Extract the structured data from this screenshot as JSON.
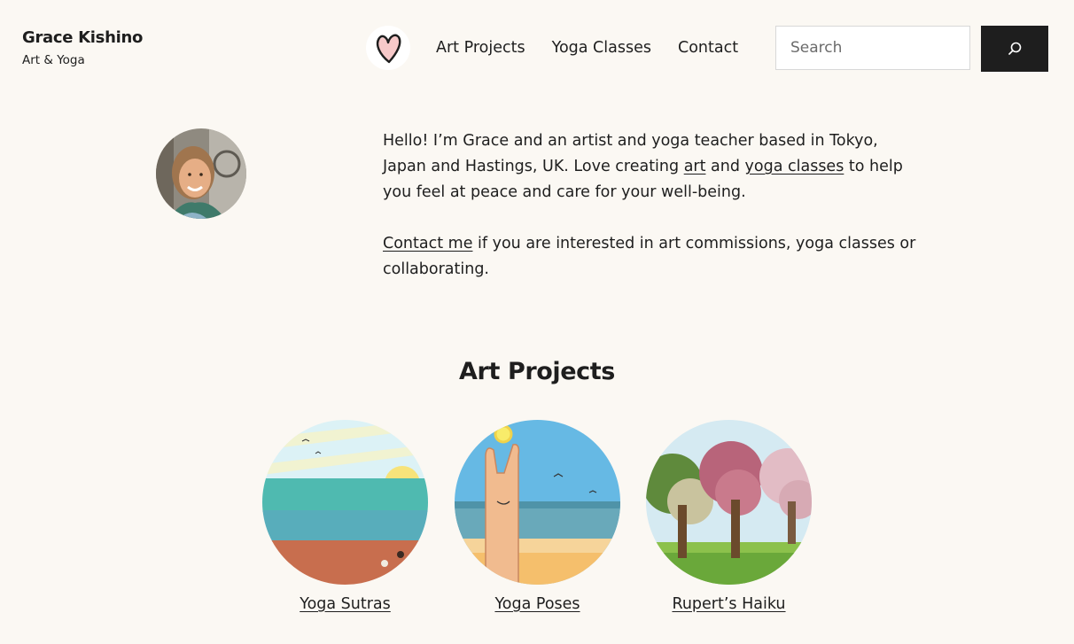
{
  "header": {
    "site_title": "Grace Kishino",
    "tagline": "Art & Yoga",
    "logo_icon": "heart-icon",
    "nav": [
      {
        "label": "Art Projects"
      },
      {
        "label": "Yoga Classes"
      },
      {
        "label": "Contact"
      }
    ],
    "search": {
      "placeholder": "Search",
      "button_icon": "search-icon"
    }
  },
  "intro": {
    "p1_before": "Hello! I’m Grace and an artist and yoga teacher based in Tokyo, Japan and Hastings, UK. Love creating ",
    "p1_link_art": "art",
    "p1_and": " and ",
    "p1_link_yoga": "yoga classes",
    "p1_after": " to help you feel at peace and care for your well-being.",
    "p2_link": "Contact me",
    "p2_after": " if you are interested in art commissions, yoga classes or collaborating."
  },
  "projects": {
    "heading": "Art Projects",
    "items": [
      {
        "label": "Yoga Sutras"
      },
      {
        "label": "Yoga Poses"
      },
      {
        "label": "Rupert’s Haiku"
      }
    ]
  },
  "colors": {
    "background": "#fbf8f3",
    "text": "#1e1e1e",
    "button": "#1e1e1e"
  }
}
